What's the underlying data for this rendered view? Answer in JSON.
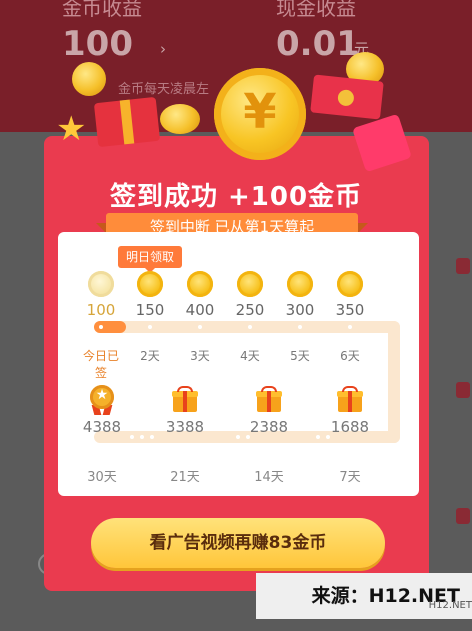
{
  "background": {
    "coin_income_label": "金币收益",
    "coin_income_value": "100",
    "cash_income_label": "现金收益",
    "cash_income_value": "0.01",
    "cash_unit": "元",
    "coin_note": "金币每天凌晨左"
  },
  "modal": {
    "title": "签到成功 +100金币",
    "ribbon": "签到中断 已从第1天算起",
    "tooltip": "明日领取",
    "days": [
      {
        "amount": "100",
        "label": "今日已签",
        "state": "done"
      },
      {
        "amount": "150",
        "label": "2天",
        "state": "next"
      },
      {
        "amount": "400",
        "label": "3天",
        "state": "pending"
      },
      {
        "amount": "250",
        "label": "4天",
        "state": "pending"
      },
      {
        "amount": "300",
        "label": "5天",
        "state": "pending"
      },
      {
        "amount": "350",
        "label": "6天",
        "state": "pending"
      }
    ],
    "milestones": [
      {
        "amount": "4388",
        "label": "30天",
        "icon": "medal-icon"
      },
      {
        "amount": "3388",
        "label": "21天",
        "icon": "gift-icon"
      },
      {
        "amount": "2388",
        "label": "14天",
        "icon": "gift-icon"
      },
      {
        "amount": "1688",
        "label": "7天",
        "icon": "gift-icon"
      }
    ],
    "cta": "看广告视频再赚83金币"
  },
  "watermark": {
    "text": "来源：H12.NET",
    "small": "H12.NET"
  },
  "colors": {
    "modal_red": "#ea3b4f",
    "accent_orange": "#ff8c3a",
    "coin_gold": "#f7c21f",
    "cta_yellow": "#ffc63a"
  }
}
